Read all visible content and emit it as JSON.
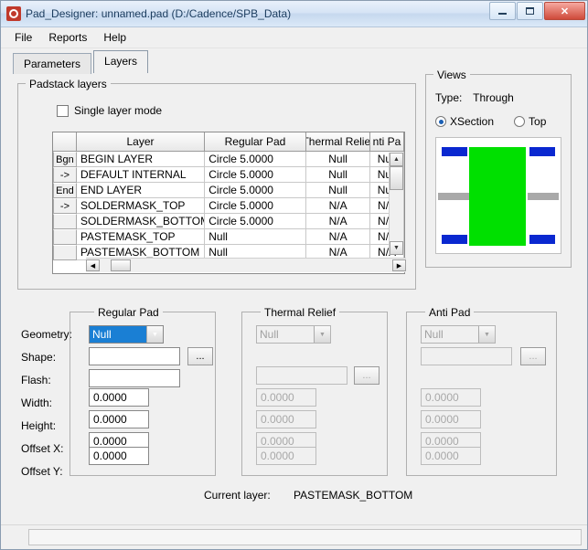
{
  "window": {
    "title": "Pad_Designer: unnamed.pad (D:/Cadence/SPB_Data)",
    "minimize": "–",
    "maximize": "□",
    "close": "✕"
  },
  "menu": [
    "File",
    "Reports",
    "Help"
  ],
  "tabs": [
    {
      "label": "Parameters",
      "active": false
    },
    {
      "label": "Layers",
      "active": true
    }
  ],
  "padstack": {
    "legend": "Padstack layers",
    "single_layer_mode": "Single layer mode",
    "columns": [
      "",
      "Layer",
      "Regular Pad",
      "Thermal Relief",
      "nti Pa"
    ],
    "rows": [
      {
        "btn": "Bgn",
        "layer": "BEGIN LAYER",
        "regular": "Circle 5.0000",
        "thermal": "Null",
        "anti": "Null"
      },
      {
        "btn": "->",
        "layer": "DEFAULT INTERNAL",
        "regular": "Circle 5.0000",
        "thermal": "Null",
        "anti": "Null"
      },
      {
        "btn": "End",
        "layer": "END LAYER",
        "regular": "Circle 5.0000",
        "thermal": "Null",
        "anti": "Null"
      },
      {
        "btn": "->",
        "layer": "SOLDERMASK_TOP",
        "regular": "Circle 5.0000",
        "thermal": "N/A",
        "anti": "N/A"
      },
      {
        "btn": "",
        "layer": "SOLDERMASK_BOTTOM",
        "regular": "Circle 5.0000",
        "thermal": "N/A",
        "anti": "N/A"
      },
      {
        "btn": "",
        "layer": "PASTEMASK_TOP",
        "regular": "Null",
        "thermal": "N/A",
        "anti": "N/A"
      },
      {
        "btn": "",
        "layer": "PASTEMASK_BOTTOM",
        "regular": "Null",
        "thermal": "N/A",
        "anti": "N/A"
      }
    ]
  },
  "views": {
    "legend": "Views",
    "type_label": "Type:",
    "type_value": "Through",
    "xsection": "XSection",
    "top": "Top"
  },
  "fields": {
    "labels": [
      "Geometry:",
      "Shape:",
      "Flash:",
      "Width:",
      "Height:",
      "Offset X:",
      "Offset Y:"
    ]
  },
  "regular_pad": {
    "legend": "Regular Pad",
    "geometry": "Null",
    "shape": "",
    "flash": "",
    "width": "0.0000",
    "height": "0.0000",
    "offset_x": "0.0000",
    "offset_y": "0.0000",
    "browse": "..."
  },
  "thermal_relief": {
    "legend": "Thermal Relief",
    "geometry": "Null",
    "shape": "",
    "width": "0.0000",
    "height": "0.0000",
    "offset_x": "0.0000",
    "offset_y": "0.0000",
    "browse": "..."
  },
  "anti_pad": {
    "legend": "Anti Pad",
    "geometry": "Null",
    "shape": "",
    "width": "0.0000",
    "height": "0.0000",
    "offset_x": "0.0000",
    "offset_y": "0.0000",
    "browse": "..."
  },
  "current_layer": {
    "label": "Current layer:",
    "value": "PASTEMASK_BOTTOM"
  },
  "colors": {
    "pad_green": "#00e000",
    "pad_blue": "#0a28d0",
    "pad_gray": "#a9a9a9",
    "selection_blue": "#1a7fd4"
  }
}
